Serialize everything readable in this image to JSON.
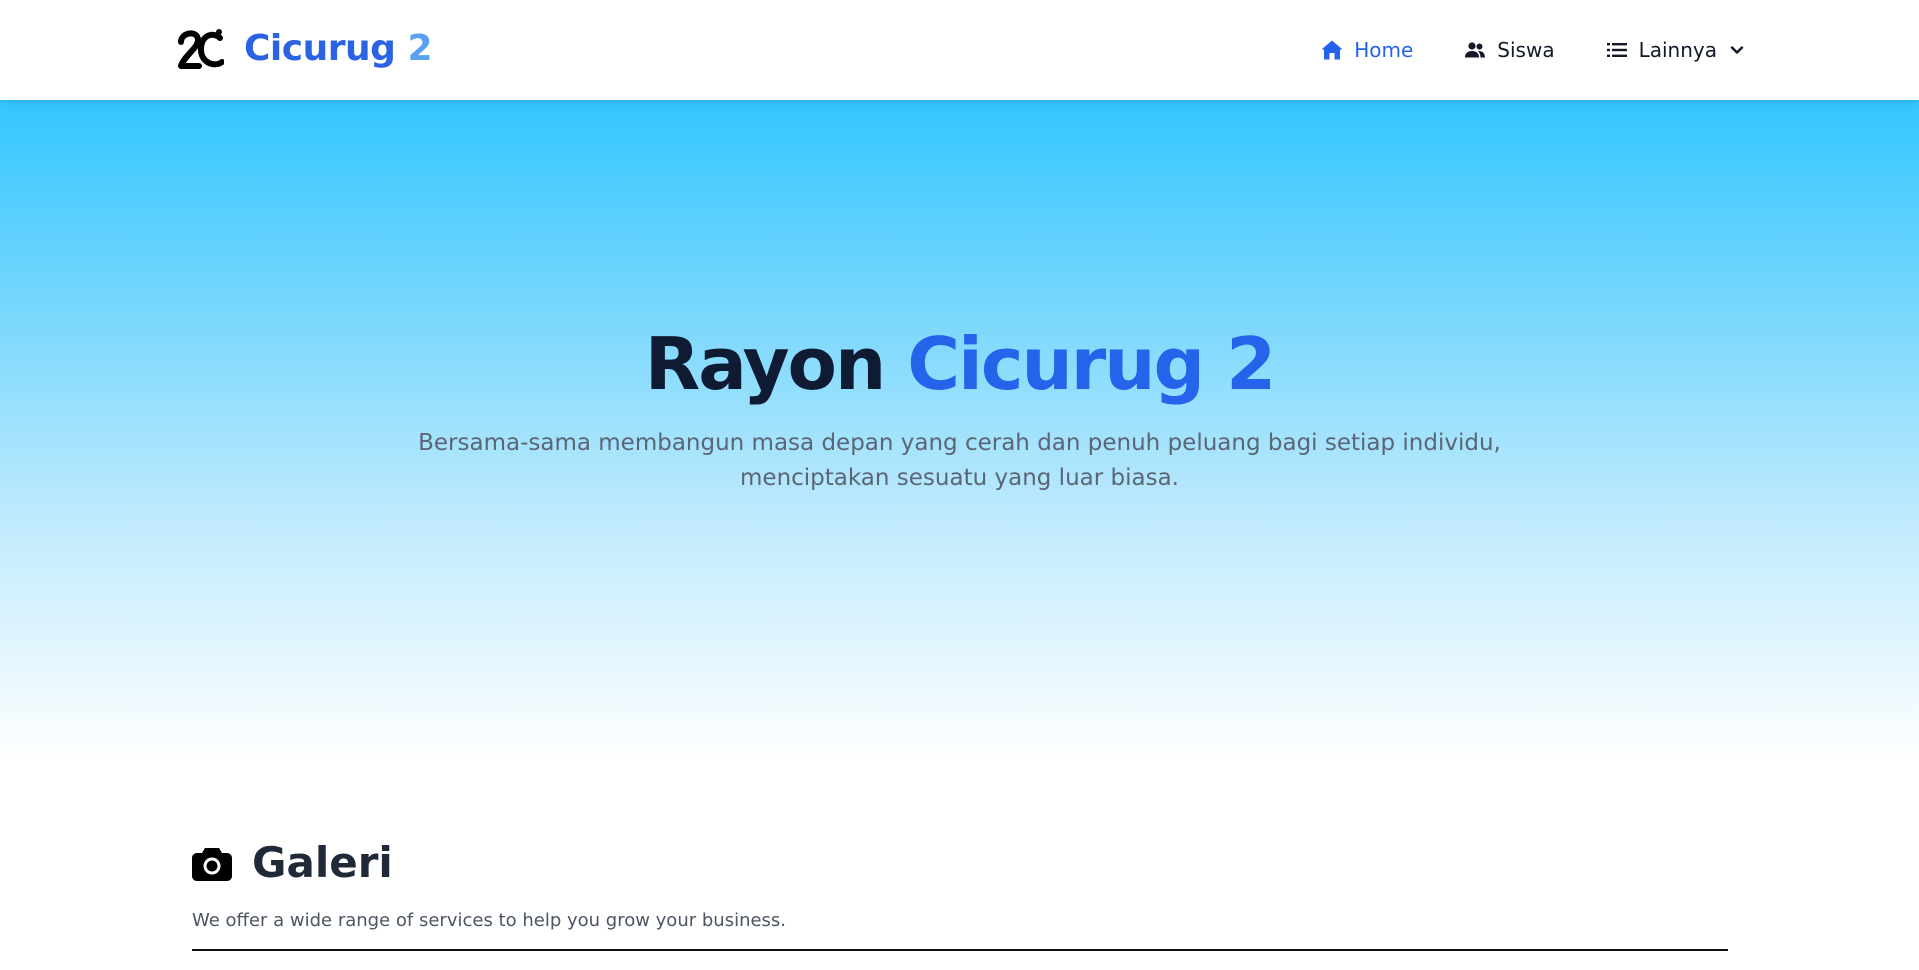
{
  "header": {
    "brand": {
      "word": "Cicurug",
      "number": "2",
      "logo_icon": "2c-logo-icon"
    },
    "nav": [
      {
        "label": "Home",
        "icon": "home-icon",
        "active": true
      },
      {
        "label": "Siswa",
        "icon": "users-icon",
        "active": false
      },
      {
        "label": "Lainnya",
        "icon": "list-icon",
        "dropdown_icon": "chevron-down-icon",
        "active": false
      }
    ]
  },
  "hero": {
    "title_prefix": "Rayon",
    "title_accent": "Cicurug 2",
    "subtitle_line1": "Bersama-sama membangun masa depan yang cerah dan penuh peluang bagi setiap individu,",
    "subtitle_line2": "menciptakan sesuatu yang luar biasa."
  },
  "gallery": {
    "icon": "camera-icon",
    "title": "Galeri",
    "subtitle": "We offer a wide range of services to help you grow your business."
  },
  "colors": {
    "accent": "#2563eb",
    "brand_number": "#5aa2f0",
    "hero_top": "#33c6ff",
    "heading": "#0f1b33"
  }
}
